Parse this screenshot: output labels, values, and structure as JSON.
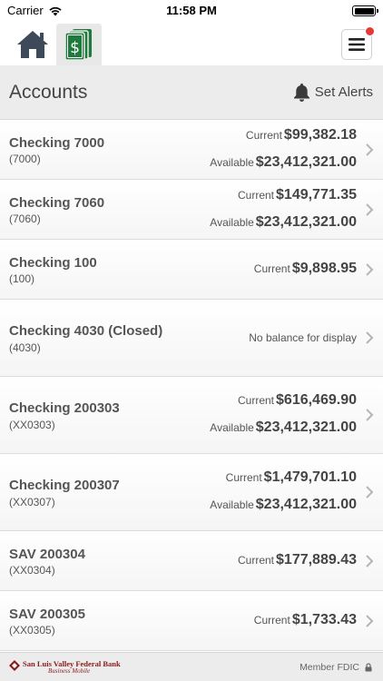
{
  "status_bar": {
    "carrier": "Carrier",
    "time": "11:58 PM"
  },
  "nav": {
    "home_icon": "home-icon",
    "accounts_icon": "dollar-bills-icon",
    "menu_icon": "hamburger-menu-icon",
    "notification_color": "#e53935",
    "accounts_icon_color": "#1e7b3c"
  },
  "header": {
    "title": "Accounts",
    "alerts_label": "Set Alerts"
  },
  "accounts": [
    {
      "name": "Checking 7000",
      "number": "(7000)",
      "balances": [
        {
          "label": "Current",
          "value": "$99,382.18"
        },
        {
          "label": "Available",
          "value": "$23,412,321.00"
        }
      ]
    },
    {
      "name": "Checking 7060",
      "number": "(7060)",
      "balances": [
        {
          "label": "Current",
          "value": "$149,771.35"
        },
        {
          "label": "Available",
          "value": "$23,412,321.00"
        }
      ]
    },
    {
      "name": "Checking 100",
      "number": "(100)",
      "balances": [
        {
          "label": "Current",
          "value": "$9,898.95"
        }
      ]
    },
    {
      "name": "Checking 4030 (Closed)",
      "number": "(4030)",
      "message": "No balance for display"
    },
    {
      "name": "Checking 200303",
      "number": "(XX0303)",
      "balances": [
        {
          "label": "Current",
          "value": "$616,469.90"
        },
        {
          "label": "Available",
          "value": "$23,412,321.00"
        }
      ]
    },
    {
      "name": "Checking 200307",
      "number": "(XX0307)",
      "balances": [
        {
          "label": "Current",
          "value": "$1,479,701.10"
        },
        {
          "label": "Available",
          "value": "$23,412,321.00"
        }
      ]
    },
    {
      "name": "SAV 200304",
      "number": "(XX0304)",
      "balances": [
        {
          "label": "Current",
          "value": "$177,889.43"
        }
      ]
    },
    {
      "name": "SAV 200305",
      "number": "(XX0305)",
      "balances": [
        {
          "label": "Current",
          "value": "$1,733.43"
        }
      ]
    }
  ],
  "footer": {
    "bank_name": "San Luis Valley Federal Bank",
    "bank_sub": "Business Mobile",
    "fdic": "Member FDIC",
    "bank_color": "#8b1a1a"
  }
}
